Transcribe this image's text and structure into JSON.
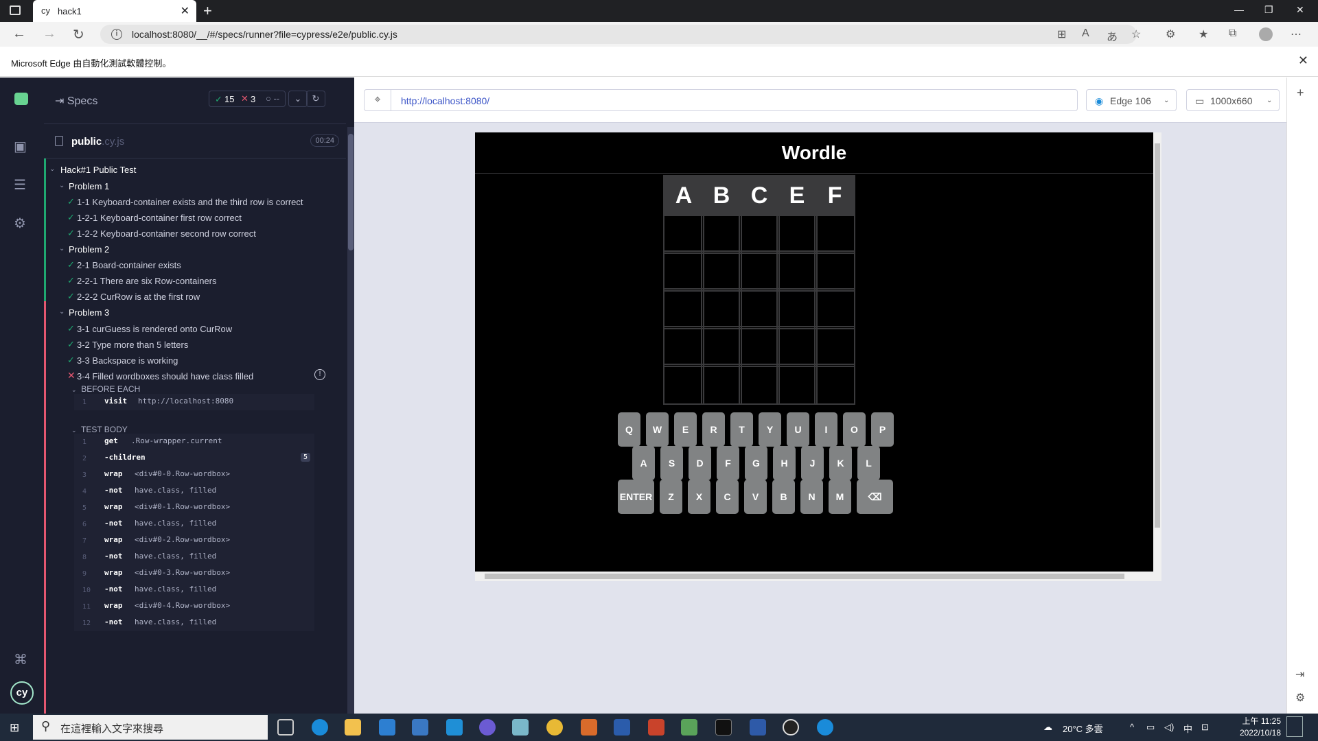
{
  "browser": {
    "tab_title": "hack1",
    "url": "localhost:8080/__/#/specs/runner?file=cypress/e2e/public.cy.js",
    "infobar_message": "Microsoft Edge 由自動化測試軟體控制。"
  },
  "reporter": {
    "specs_label": "Specs",
    "passed_count": "15",
    "failed_count": "3",
    "pending_count": "--",
    "file_name": "public",
    "file_ext": ".cy.js",
    "duration": "00:24",
    "suite": "Hack#1 Public Test",
    "problems": [
      {
        "title": "Problem 1",
        "tests": [
          "1-1 Keyboard-container exists and the third row is correct",
          "1-2-1 Keyboard-container first row correct",
          "1-2-2 Keyboard-container second row correct"
        ]
      },
      {
        "title": "Problem 2",
        "tests": [
          "2-1 Board-container exists",
          "2-2-1 There are six Row-containers",
          "2-2-2 CurRow is at the first row"
        ]
      },
      {
        "title": "Problem 3",
        "tests": [
          "3-1 curGuess is rendered onto CurRow",
          "3-2 Type more than 5 letters",
          "3-3 Backspace is working",
          "3-4 Filled wordboxes should have class filled"
        ]
      }
    ],
    "before_each_label": "BEFORE EACH",
    "test_body_label": "TEST BODY",
    "before_each_cmd": {
      "n": "1",
      "name": "visit",
      "msg": "http://localhost:8080"
    },
    "commands": [
      {
        "n": "1",
        "name": "get",
        "msg": ".Row-wrapper.current"
      },
      {
        "n": "2",
        "name": "-children",
        "msg": "",
        "badge": "5"
      },
      {
        "n": "3",
        "name": "wrap",
        "msg": "<div#0-0.Row-wordbox>"
      },
      {
        "n": "4",
        "name": "-not",
        "msg": "have.class, filled"
      },
      {
        "n": "5",
        "name": "wrap",
        "msg": "<div#0-1.Row-wordbox>"
      },
      {
        "n": "6",
        "name": "-not",
        "msg": "have.class, filled"
      },
      {
        "n": "7",
        "name": "wrap",
        "msg": "<div#0-2.Row-wordbox>"
      },
      {
        "n": "8",
        "name": "-not",
        "msg": "have.class, filled"
      },
      {
        "n": "9",
        "name": "wrap",
        "msg": "<div#0-3.Row-wordbox>"
      },
      {
        "n": "10",
        "name": "-not",
        "msg": "have.class, filled"
      },
      {
        "n": "11",
        "name": "wrap",
        "msg": "<div#0-4.Row-wordbox>"
      },
      {
        "n": "12",
        "name": "-not",
        "msg": "have.class, filled"
      }
    ]
  },
  "aut": {
    "url": "http://localhost:8080/",
    "browser": "Edge 106",
    "viewport": "1000x660"
  },
  "wordle": {
    "title": "Wordle",
    "first_row": [
      "A",
      "B",
      "C",
      "E",
      "F"
    ],
    "keyboard_rows": [
      [
        "Q",
        "W",
        "E",
        "R",
        "T",
        "Y",
        "U",
        "I",
        "O",
        "P"
      ],
      [
        "A",
        "S",
        "D",
        "F",
        "G",
        "H",
        "J",
        "K",
        "L"
      ],
      [
        "ENTER",
        "Z",
        "X",
        "C",
        "V",
        "B",
        "N",
        "M",
        "⌫"
      ]
    ]
  },
  "taskbar": {
    "search_placeholder": "在這裡輸入文字來搜尋",
    "weather": "20°C 多雲",
    "ime": "中",
    "time": "上午 11:25",
    "date": "2022/10/18"
  },
  "colors": {
    "pass": "#1fa971",
    "fail": "#e45770",
    "tile": "#3a3a3c",
    "key": "#818384"
  }
}
